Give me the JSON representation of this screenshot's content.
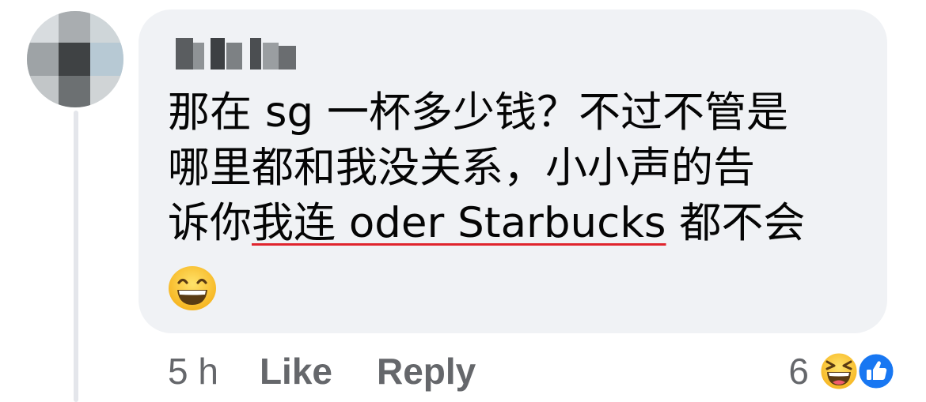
{
  "comment": {
    "lines": [
      "那在 sg 一杯多少钱？不过不管是",
      "哪里都和我没关系，小小声的告"
    ],
    "line3_prefix": "诉你",
    "line3_underlined": "我连 oder Starbucks",
    "line3_suffix": " 都不会",
    "emoji": "grinning-face-with-smiling-eyes"
  },
  "actions": {
    "time": "5 h",
    "like_label": "Like",
    "reply_label": "Reply"
  },
  "reactions": {
    "count": "6",
    "icons": [
      "laughing-face-icon",
      "thumbs-up-icon"
    ]
  },
  "colors": {
    "bubble": "#f0f2f5",
    "text": "#050505",
    "meta": "#65676b",
    "underline": "#e0242d",
    "like_blue": "#1877f2"
  }
}
